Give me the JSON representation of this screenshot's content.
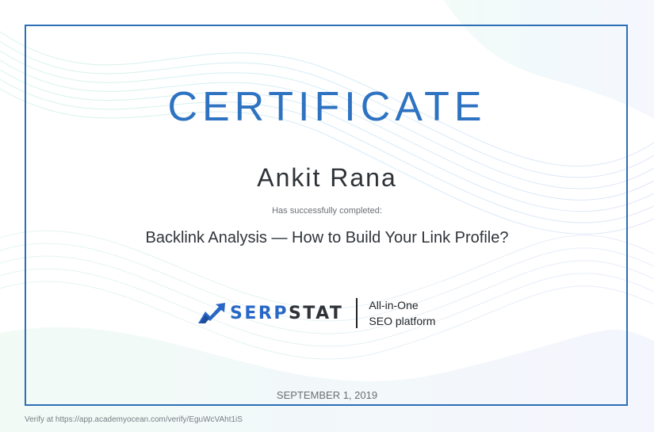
{
  "certificate": {
    "title": "CERTIFICATE",
    "recipient": "Ankit Rana",
    "completed_text": "Has successfully completed:",
    "course": "Backlink Analysis — How to Build Your Link Profile?",
    "date": "SEPTEMBER 1, 2019",
    "verify_text": "Verify at https://app.academyocean.com/verify/EguWcVAht1iS"
  },
  "logo": {
    "icon": "serpstat-chart-arrow-icon",
    "wordmark_blue": "SERP",
    "wordmark_dark": "STAT",
    "tagline_line1": "All-in-One",
    "tagline_line2": "SEO platform"
  },
  "colors": {
    "accent": "#2e73c1",
    "frame": "#2c6fb6",
    "text_dark": "#2f3338",
    "text_muted": "#6b6f74",
    "brand_blue": "#2867c5"
  }
}
